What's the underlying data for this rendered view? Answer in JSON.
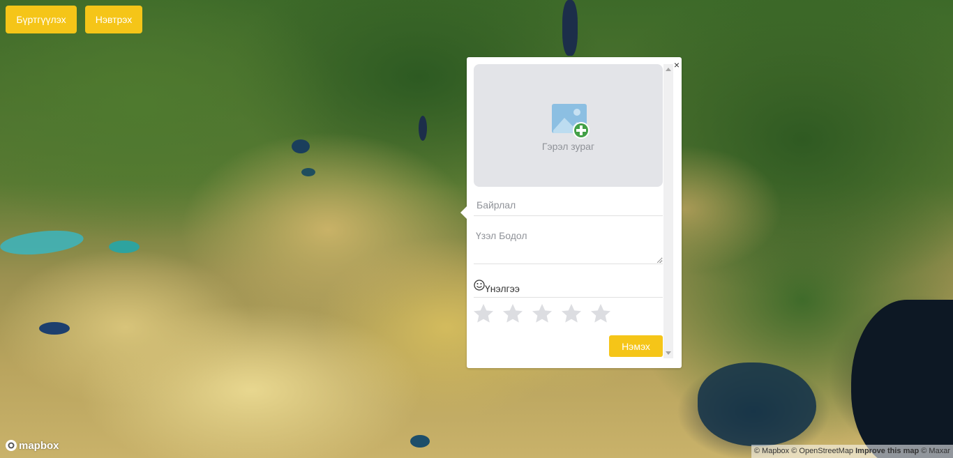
{
  "header": {
    "register_label": "Бүртгүүлэх",
    "login_label": "Нэвтрэх"
  },
  "popup": {
    "close_glyph": "×",
    "image_label": "Гэрэл зураг",
    "location_placeholder": "Байрлал",
    "review_placeholder": "Үзэл Бодол",
    "rating_label": "Үнэлгээ",
    "rating_value": 0,
    "rating_max": 5,
    "submit_label": "Нэмэх"
  },
  "map": {
    "logo_text": "mapbox",
    "attribution": {
      "mapbox": "© Mapbox",
      "osm": "© OpenStreetMap",
      "improve": "Improve this map",
      "maxar": "© Maxar"
    }
  },
  "colors": {
    "accent": "#f5c518",
    "image_area": "#e3e4e8",
    "star_empty": "#dcdde1",
    "icon_plus": "#43a047",
    "icon_picture": "#8cbfe2"
  },
  "icons": [
    "image-add-icon",
    "smiley-icon",
    "star-icon",
    "close-icon",
    "mapbox-logo-icon"
  ]
}
